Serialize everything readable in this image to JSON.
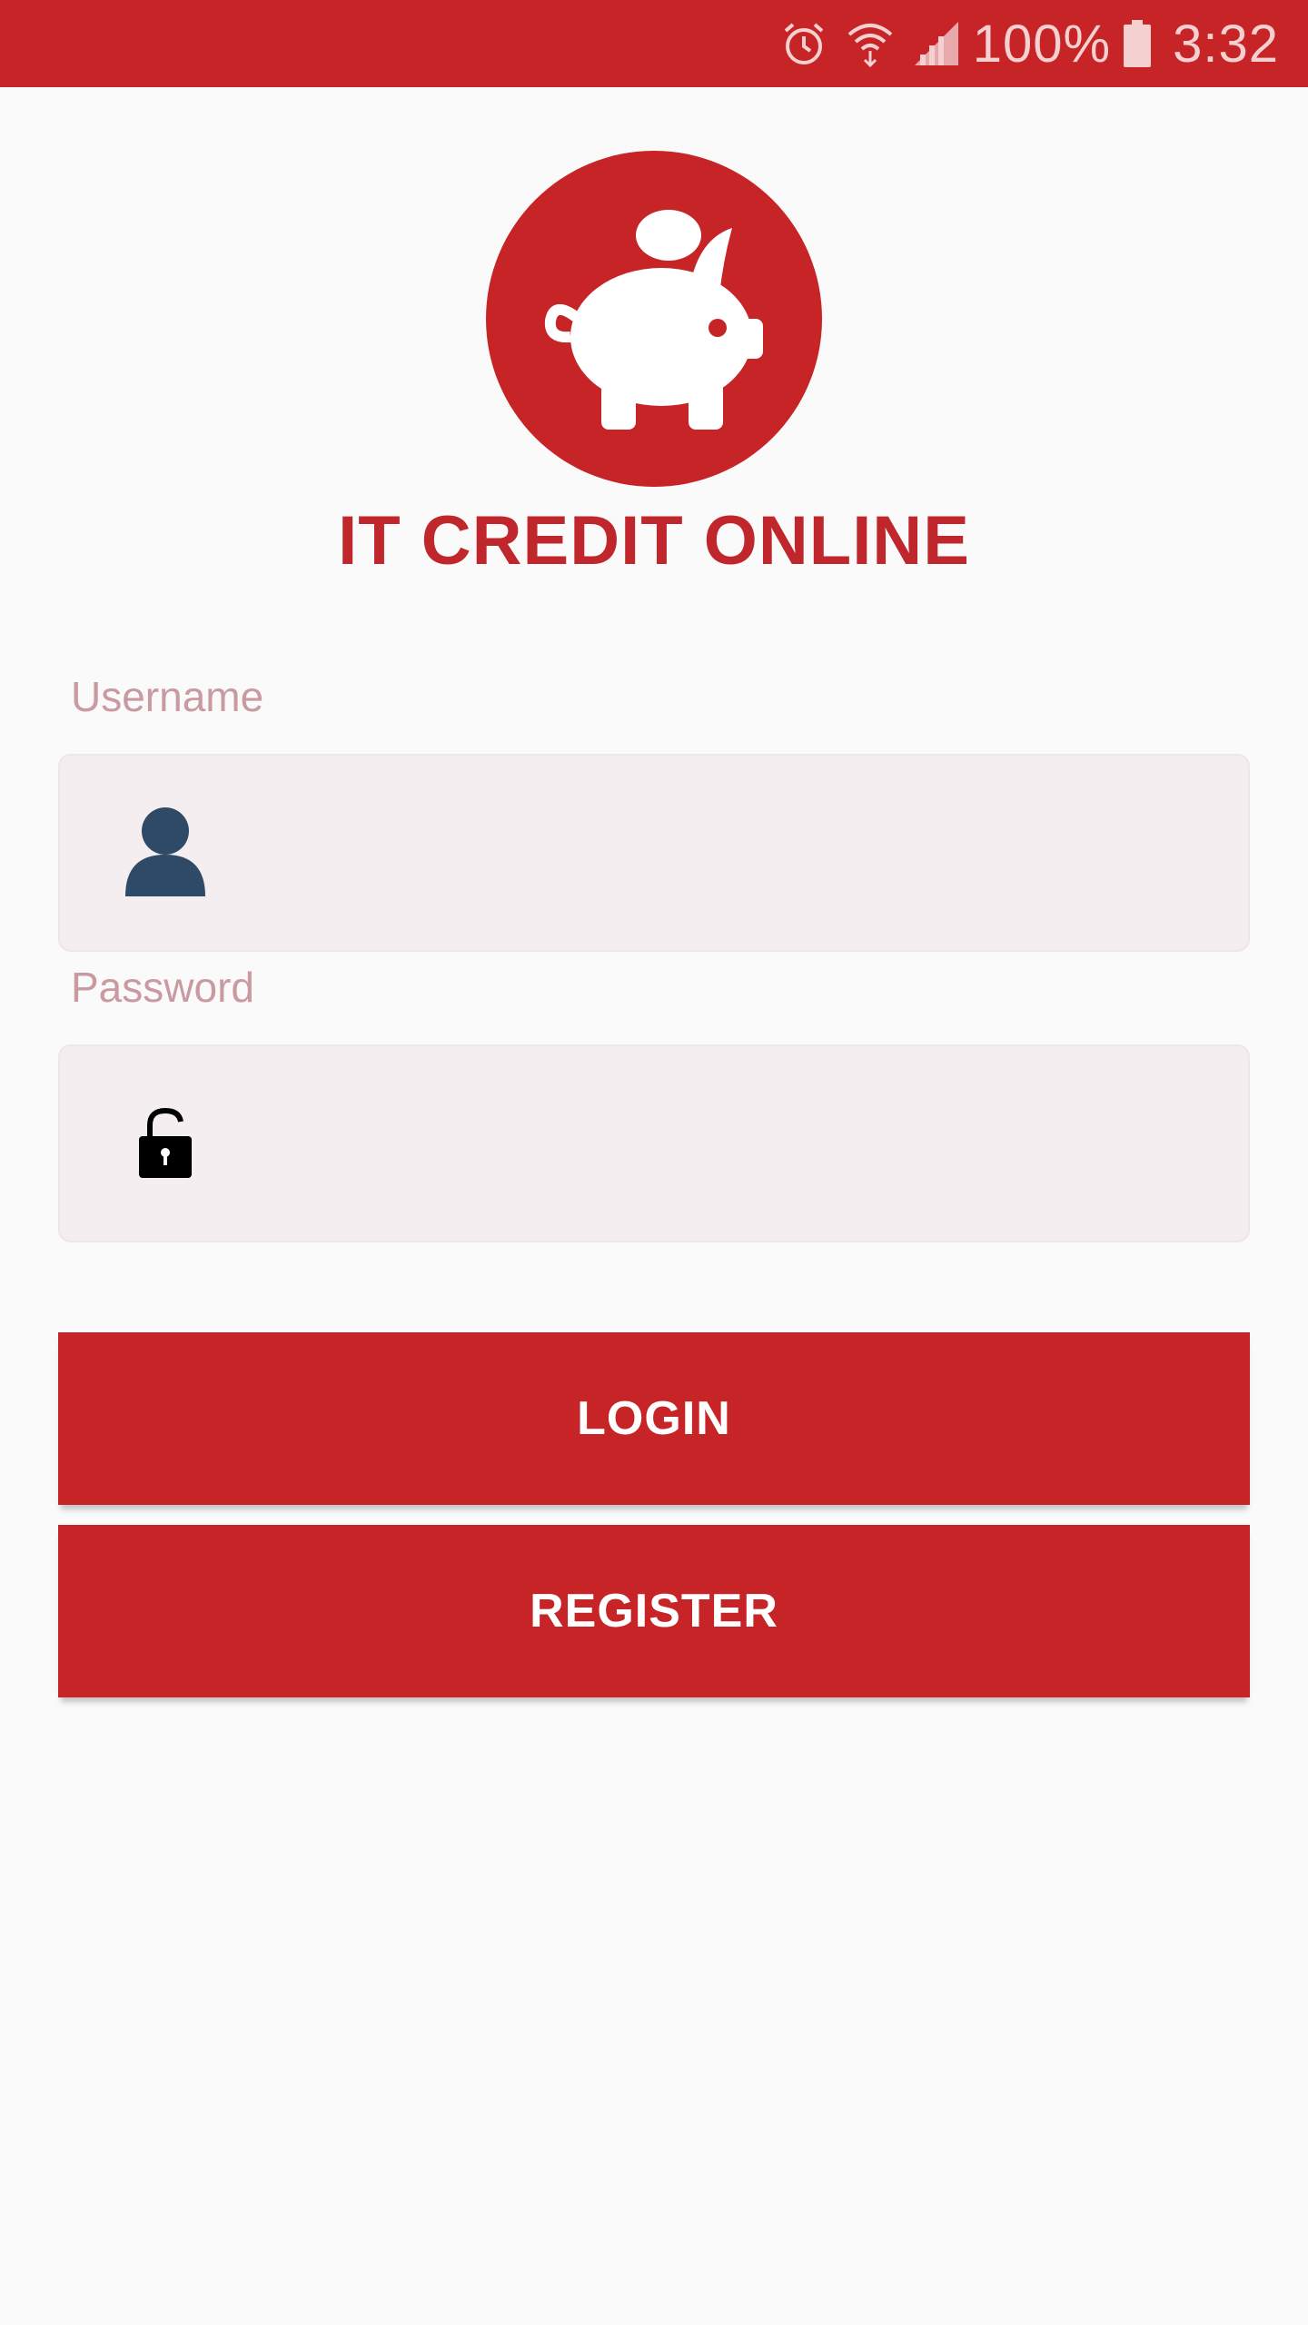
{
  "status_bar": {
    "battery": "100%",
    "time": "3:32",
    "icons": [
      "alarm-icon",
      "wifi-icon",
      "signal-icon",
      "battery-icon"
    ]
  },
  "app": {
    "title": "IT CREDIT ONLINE",
    "logo_icon": "piggy-bank-icon"
  },
  "form": {
    "username_label": "Username",
    "username_value": "",
    "username_icon": "user-icon",
    "password_label": "Password",
    "password_value": "",
    "password_icon": "unlock-icon"
  },
  "buttons": {
    "login": "LOGIN",
    "register": "REGISTER"
  },
  "colors": {
    "primary": "#c62426",
    "label": "#c99aa0",
    "field_bg": "#f5eef1",
    "user_icon": "#2f4a66"
  }
}
